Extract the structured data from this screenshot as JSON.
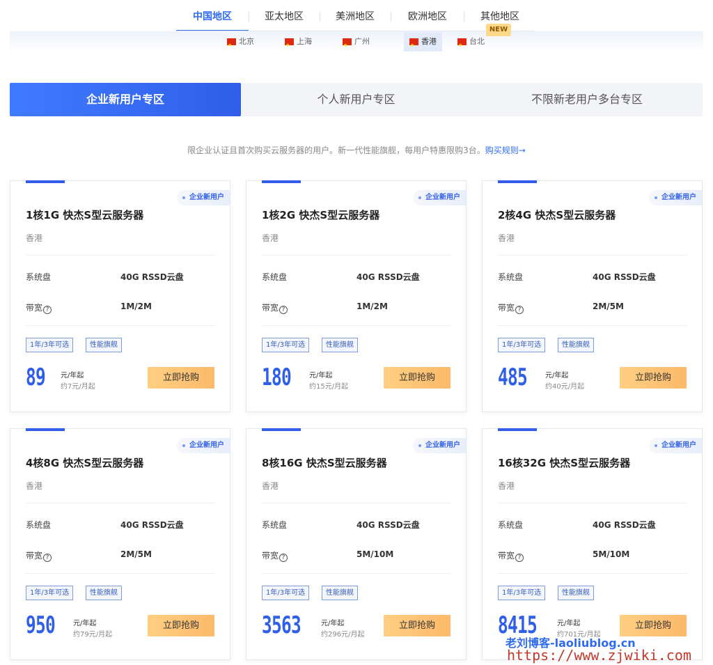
{
  "region_tabs": [
    {
      "label": "中国地区",
      "active": true
    },
    {
      "label": "亚太地区",
      "active": false
    },
    {
      "label": "美洲地区",
      "active": false
    },
    {
      "label": "欧洲地区",
      "active": false
    },
    {
      "label": "其他地区",
      "active": false
    }
  ],
  "new_badge": "NEW",
  "cities": [
    {
      "label": "北京",
      "active": false
    },
    {
      "label": "上海",
      "active": false
    },
    {
      "label": "广州",
      "active": false
    },
    {
      "label": "香港",
      "active": true
    },
    {
      "label": "台北",
      "active": false
    }
  ],
  "zone_tabs": [
    {
      "label": "企业新用户专区",
      "active": true
    },
    {
      "label": "个人新用户专区",
      "active": false
    },
    {
      "label": "不限新老用户多台专区",
      "active": false
    }
  ],
  "description": {
    "text": "限企业认证且首次购买云服务器的用户。新一代性能旗舰，每用户特惠限购3台。",
    "link": "购买规则→"
  },
  "cards": [
    {
      "tag": "企业新用户",
      "title": "1核1G 快杰S型云服务器",
      "region": "香港",
      "disk_label": "系统盘",
      "disk": "40G RSSD云盘",
      "bw_label": "带宽",
      "bandwidth": "1M/2M",
      "chip1": "1年/3年可选",
      "chip2": "性能旗舰",
      "price": "89",
      "unit": "元/年起",
      "monthly": "约7元/月起",
      "button": "立即抢购"
    },
    {
      "tag": "企业新用户",
      "title": "1核2G 快杰S型云服务器",
      "region": "香港",
      "disk_label": "系统盘",
      "disk": "40G RSSD云盘",
      "bw_label": "带宽",
      "bandwidth": "1M/2M",
      "chip1": "1年/3年可选",
      "chip2": "性能旗舰",
      "price": "180",
      "unit": "元/年起",
      "monthly": "约15元/月起",
      "button": "立即抢购"
    },
    {
      "tag": "企业新用户",
      "title": "2核4G 快杰S型云服务器",
      "region": "香港",
      "disk_label": "系统盘",
      "disk": "40G RSSD云盘",
      "bw_label": "带宽",
      "bandwidth": "2M/5M",
      "chip1": "1年/3年可选",
      "chip2": "性能旗舰",
      "price": "485",
      "unit": "元/年起",
      "monthly": "约40元/月起",
      "button": "立即抢购"
    },
    {
      "tag": "企业新用户",
      "title": "4核8G 快杰S型云服务器",
      "region": "香港",
      "disk_label": "系统盘",
      "disk": "40G RSSD云盘",
      "bw_label": "带宽",
      "bandwidth": "2M/5M",
      "chip1": "1年/3年可选",
      "chip2": "性能旗舰",
      "price": "950",
      "unit": "元/年起",
      "monthly": "约79元/月起",
      "button": "立即抢购"
    },
    {
      "tag": "企业新用户",
      "title": "8核16G 快杰S型云服务器",
      "region": "香港",
      "disk_label": "系统盘",
      "disk": "40G RSSD云盘",
      "bw_label": "带宽",
      "bandwidth": "5M/10M",
      "chip1": "1年/3年可选",
      "chip2": "性能旗舰",
      "price": "3563",
      "unit": "元/年起",
      "monthly": "约296元/月起",
      "button": "立即抢购"
    },
    {
      "tag": "企业新用户",
      "title": "16核32G 快杰S型云服务器",
      "region": "香港",
      "disk_label": "系统盘",
      "disk": "40G RSSD云盘",
      "bw_label": "带宽",
      "bandwidth": "5M/10M",
      "chip1": "1年/3年可选",
      "chip2": "性能旗舰",
      "price": "8415",
      "unit": "元/年起",
      "monthly": "约701元/月起",
      "button": "立即抢购"
    }
  ],
  "watermark": {
    "name": "老刘博客-laoliublog.cn",
    "url": "https://www.zjwiki.com"
  },
  "colors": {
    "accent": "#2f5ee8",
    "button": "#fcb96a",
    "flag": "#de2910"
  }
}
